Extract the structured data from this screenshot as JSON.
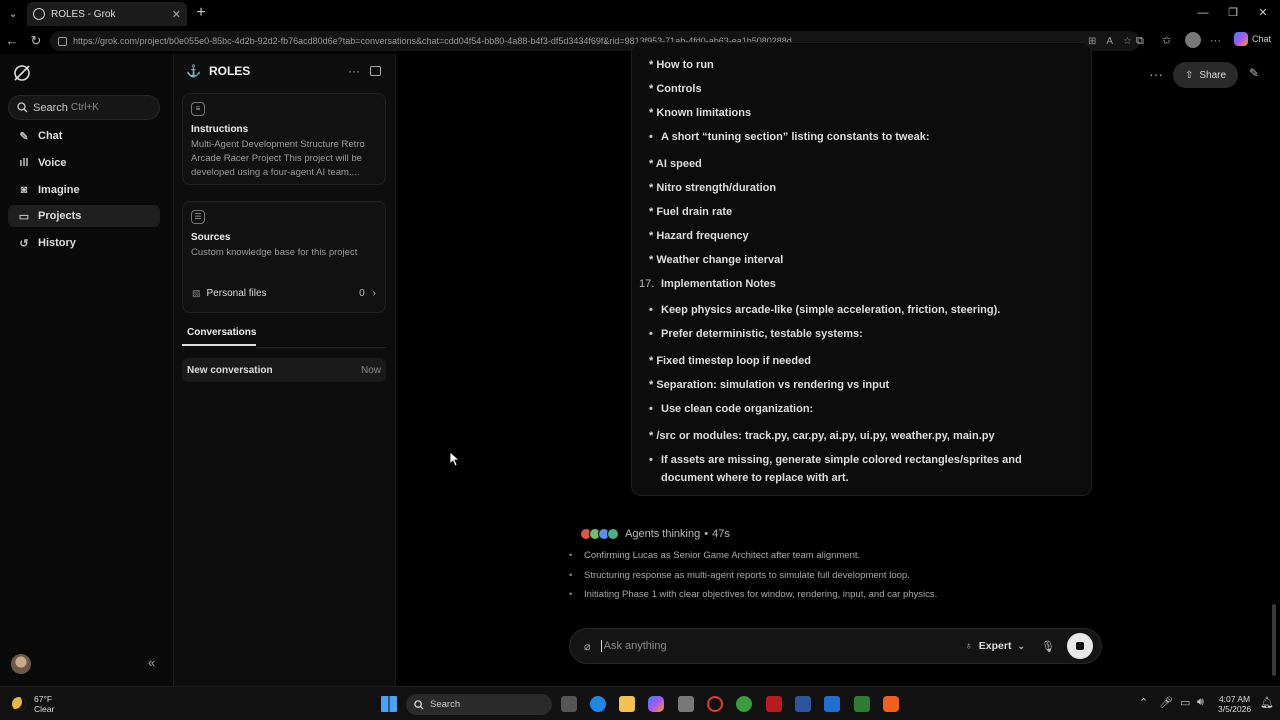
{
  "browser": {
    "tab_title": "ROLES - Grok",
    "url": "https://grok.com/project/b0e055e0-85bc-4d2b-92d2-fb76acd80d6e?tab=conversations&chat=cdd04f54-bb80-4a88-b4f3-df5d3434f69f&rid=9813f953-71ab-4fd0-ab63-ea1b5080288d",
    "copilot_label": "Chat"
  },
  "sidebar": {
    "search_label": "Search",
    "search_shortcut": "Ctrl+K",
    "items": [
      {
        "label": "Chat",
        "icon": "edit-icon"
      },
      {
        "label": "Voice",
        "icon": "waveform-icon"
      },
      {
        "label": "Imagine",
        "icon": "image-icon"
      },
      {
        "label": "Projects",
        "icon": "folder-icon"
      },
      {
        "label": "History",
        "icon": "history-icon"
      }
    ],
    "active": "Projects"
  },
  "project": {
    "name": "ROLES",
    "instructions_title": "Instructions",
    "instructions_body": "Multi-Agent Development Structure Retro Arcade Racer Project This project will be developed using a four-agent AI team....",
    "sources_title": "Sources",
    "sources_body": "Custom knowledge base for this project",
    "personal_files_label": "Personal files",
    "personal_files_count": "0",
    "conversations_tab": "Conversations",
    "conversation": {
      "title": "New conversation",
      "time": "Now"
    }
  },
  "main": {
    "share_label": "Share",
    "message_lines": [
      {
        "text": "* How to run",
        "style": "plain"
      },
      {
        "text": "* Controls",
        "style": "plain"
      },
      {
        "text": "* Known limitations",
        "style": "plain"
      },
      {
        "text": "A short “tuning section” listing constants to tweak:",
        "style": "bullet"
      },
      {
        "text": "* AI speed",
        "style": "plain"
      },
      {
        "text": "* Nitro strength/duration",
        "style": "plain"
      },
      {
        "text": "* Fuel drain rate",
        "style": "plain"
      },
      {
        "text": "* Hazard frequency",
        "style": "plain"
      },
      {
        "text": "* Weather change interval",
        "style": "plain"
      },
      {
        "text": "Implementation Notes",
        "style": "numbered",
        "number": "17."
      },
      {
        "text": "Keep physics arcade-like (simple acceleration, friction, steering).",
        "style": "bullet"
      },
      {
        "text": "Prefer deterministic, testable systems:",
        "style": "bullet"
      },
      {
        "text": "* Fixed timestep loop if needed",
        "style": "plain"
      },
      {
        "text": "* Separation: simulation vs rendering vs input",
        "style": "plain"
      },
      {
        "text": "Use clean code organization:",
        "style": "bullet"
      },
      {
        "text": "* /src or modules: track.py, car.py, ai.py, ui.py, weather.py, main.py",
        "style": "plain"
      },
      {
        "text": "If assets are missing, generate simple colored rectangles/sprites and document where to replace with art.",
        "style": "bullet"
      }
    ],
    "thinking_label": "Agents thinking",
    "thinking_time": "47s",
    "thinking_bullets": [
      "Confirming Lucas as Senior Game Architect after team alignment.",
      "Structuring response as multi-agent reports to simulate full development loop.",
      "Initiating Phase 1 with clear objectives for window, rendering, input, and car physics."
    ],
    "composer_placeholder": "Ask anything",
    "mode_label": "Expert"
  },
  "taskbar": {
    "temperature": "67°F",
    "condition": "Clear",
    "search_label": "Search",
    "time": "4:07 AM",
    "date": "3/5/2026"
  },
  "colors": {
    "background": "#000000",
    "panel": "#0d0d0d",
    "accent_folder": "#d9a441"
  }
}
